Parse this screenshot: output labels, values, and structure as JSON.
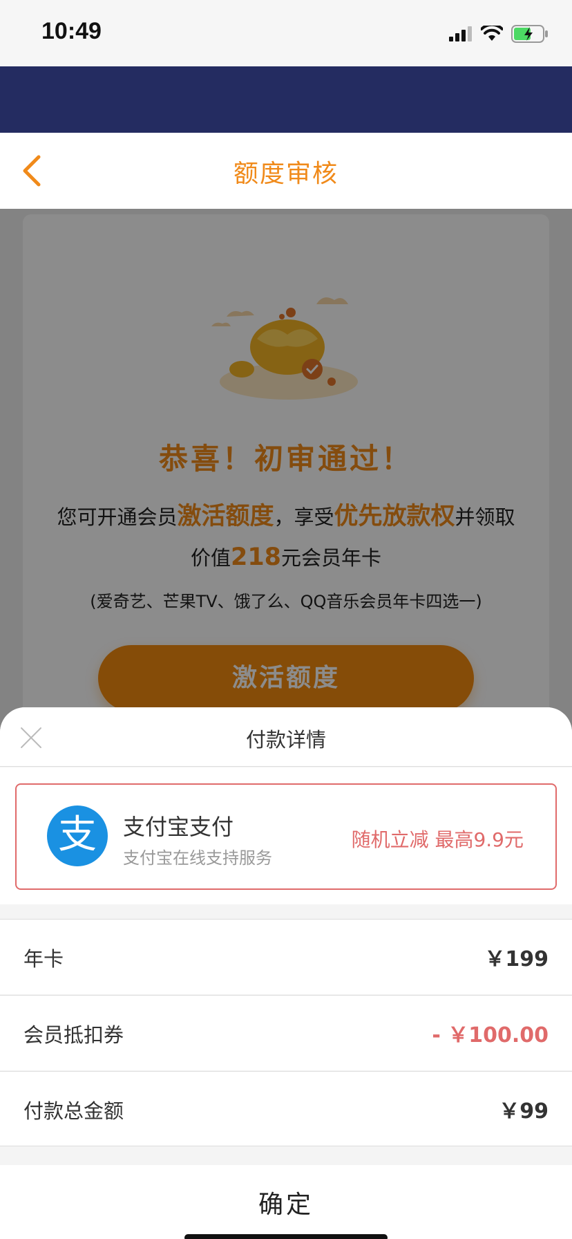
{
  "status_bar": {
    "time": "10:49",
    "icons": [
      "cellular-signal-icon",
      "wifi-icon",
      "battery-charging-icon"
    ]
  },
  "nav": {
    "title": "额度审核",
    "back_icon": "chevron-left-icon"
  },
  "card": {
    "congrats": "恭喜！初审通过！",
    "desc_1": "您可开通会员",
    "desc_hl_1": "激活额度",
    "desc_2": "，享受",
    "desc_hl_2": "优先放款权",
    "desc_3": "并领取价值",
    "desc_hl_3": "218",
    "desc_4": "元会员年卡",
    "choices": "(爱奇艺、芒果TV、饿了么、QQ音乐会员年卡四选一)",
    "activate_button": "激活额度"
  },
  "sheet": {
    "title": "付款详情",
    "close_icon": "close-icon",
    "payment_method": {
      "logo_glyph": "支",
      "name": "支付宝支付",
      "subtitle": "支付宝在线支持服务",
      "promo": "随机立减 最高9.9元"
    },
    "rows": [
      {
        "label": "年卡",
        "value": "￥199"
      },
      {
        "label": "会员抵扣券",
        "value": "- ￥100.00"
      },
      {
        "label": "付款总金额",
        "value": "￥99"
      }
    ],
    "confirm_button": "确定"
  },
  "colors": {
    "brand_band": "#242c61",
    "accent_orange": "#f08a1a",
    "alipay_blue": "#1a91e2",
    "discount_red": "#e06a6a"
  }
}
